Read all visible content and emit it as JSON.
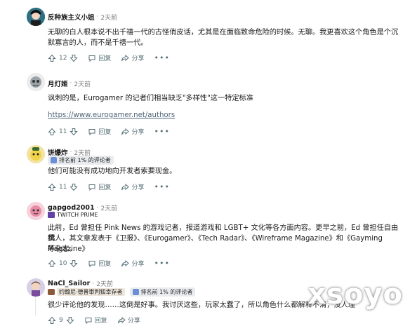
{
  "comments": [
    {
      "author": "反种族主义小姐",
      "time": "2天前",
      "text": "无聊的白人根本说不出千禧一代的古怪俏皮话，尤其是在面临致命危险的时候。无聊。我更喜欢这个角色是个沉默寡言的人，而不是千禧一代。",
      "votes": "12",
      "reply": "回复",
      "share": "分享",
      "more": "•••"
    },
    {
      "author": "月灯姬",
      "time": "2天前",
      "text": "讽刺的是，Eurogamer 的记者们相当缺乏\"多样性\"这一特定标准",
      "link": "https://www.eurogamer.net/authors",
      "votes": "11",
      "reply": "回复",
      "share": "分享",
      "more": "•••"
    },
    {
      "author": "饼爆炸",
      "time": "2天前",
      "badge": "排名前 1% 的评论者",
      "text": "他们可能没有成功地向开发者索要现金。",
      "votes": "11",
      "reply": "回复",
      "share": "分享",
      "more": "•••"
    },
    {
      "author": "gapgod2001",
      "time": "2天前",
      "flair": "TWITCH PRIME",
      "text_lines": [
        "此前，Ed 曾担任 Pink News 的游戏记者，报道游戏和 LGBT+ 文化等各方面内容。更早之前，Ed 曾担任自由撰",
        "稿人，其文章发表于《卫报》、《Eurogamer》、《Tech Radar》、《Wireframe Magazine》和《Gayming Magazine》",
        "等杂志。"
      ],
      "votes": "10",
      "reply": "回复",
      "share": "分享",
      "more": "•••"
    },
    {
      "author": "NaCl_Sailor",
      "time": "2天前",
      "flair": "约翰尼·德普审判狐幸存者",
      "badge": "排名前 1% 的评论者",
      "text": "很少评论他的发现……这倒是好事。我讨厌这些，玩家太蠢了，所以角色什么都解释不清，没人理",
      "votes": "9",
      "reply": "回复",
      "share": "分享"
    }
  ],
  "watermark": "xsoyo",
  "colors": {
    "link": "#4f6479",
    "meta": "#7c7c7c",
    "action": "#576f76"
  }
}
